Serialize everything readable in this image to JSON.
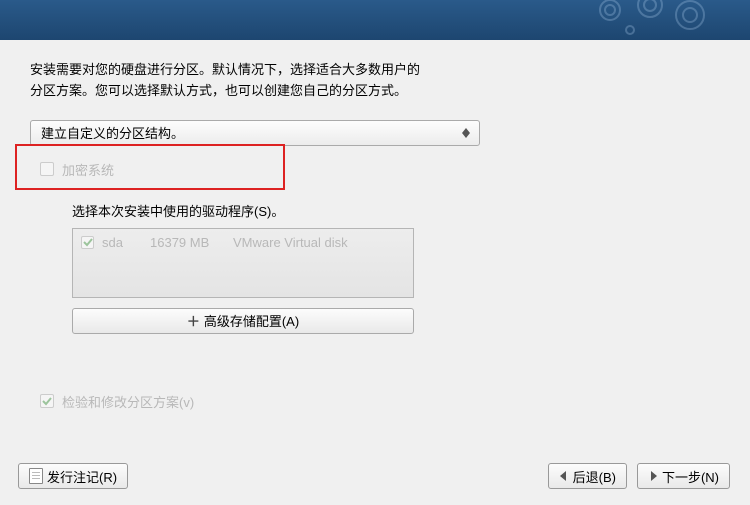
{
  "intro": {
    "line1": "安装需要对您的硬盘进行分区。默认情况下，选择适合大多数用户的",
    "line2": "分区方案。您可以选择默认方式，也可以创建您自己的分区方式。"
  },
  "partition_select": {
    "value": "建立自定义的分区结构。"
  },
  "encrypt": {
    "label": "加密系统",
    "checked": false,
    "enabled": false
  },
  "drives": {
    "label": "选择本次安装中使用的驱动程序(S)。",
    "items": [
      {
        "checked": true,
        "name": "sda",
        "size": "16379 MB",
        "desc": "VMware Virtual disk"
      }
    ]
  },
  "advanced_btn": "高级存储配置(A)",
  "review": {
    "label": "检验和修改分区方案(v)",
    "checked": true,
    "enabled": false
  },
  "footer": {
    "release_notes": "发行注记(R)",
    "back": "后退(B)",
    "next": "下一步(N)"
  }
}
